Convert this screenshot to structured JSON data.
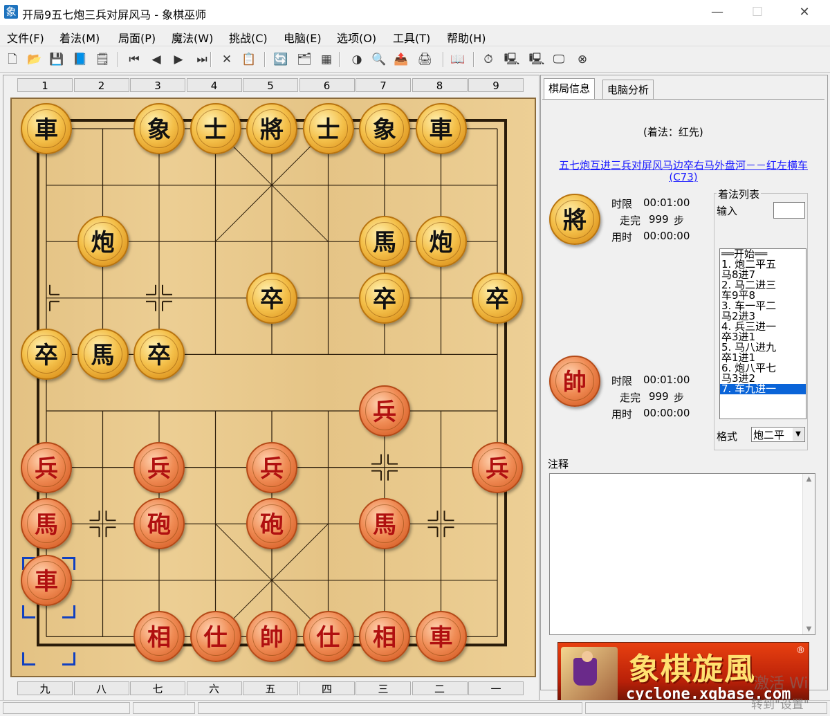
{
  "window": {
    "title": "开局9五七炮三兵对屏风马 - 象棋巫师",
    "app_icon": "象",
    "minimize": "—",
    "maximize": "☐",
    "close": "✕"
  },
  "menu": [
    "文件(F)",
    "着法(M)",
    "局面(P)",
    "魔法(W)",
    "挑战(C)",
    "电脑(E)",
    "选项(O)",
    "工具(T)",
    "帮助(H)"
  ],
  "toolbar_icons": [
    "new-file-icon",
    "open-folder-icon",
    "save-icon",
    "book-icon",
    "properties-icon",
    "first-move-icon",
    "prev-move-icon",
    "next-move-icon",
    "last-move-icon",
    "delete-icon",
    "paste-icon",
    "flip-board-icon",
    "move-tree-icon",
    "board-grid-icon",
    "color-wheel-icon",
    "search-icon",
    "export-icon",
    "print-icon",
    "manual-icon",
    "timer-icon",
    "engine-1-icon",
    "engine-2-icon",
    "monitor-icon",
    "stop-icon"
  ],
  "toolbar_glyphs": [
    "🗋",
    "📂",
    "💾",
    "📘",
    "🗒",
    "⏮",
    "◀",
    "▶",
    "⏭",
    "✕",
    "📋",
    "🔄",
    "🗂",
    "▦",
    "◑",
    "🔍",
    "📤",
    "🖨",
    "📖",
    "⏱",
    "🖳",
    "🖳",
    "🖵",
    "⊗"
  ],
  "board": {
    "top_numbers": [
      "1",
      "2",
      "3",
      "4",
      "5",
      "6",
      "7",
      "8",
      "9"
    ],
    "bottom_numbers": [
      "九",
      "八",
      "七",
      "六",
      "五",
      "四",
      "三",
      "二",
      "一"
    ],
    "pieces": [
      {
        "name": "black-chariot",
        "ch": "車",
        "side": "black"
      },
      {
        "name": "black-elephant",
        "ch": "象",
        "side": "black"
      },
      {
        "name": "black-advisor",
        "ch": "士",
        "side": "black"
      },
      {
        "name": "black-general",
        "ch": "將",
        "side": "black"
      },
      {
        "name": "black-advisor",
        "ch": "士",
        "side": "black"
      },
      {
        "name": "black-elephant",
        "ch": "象",
        "side": "black"
      },
      {
        "name": "black-chariot",
        "ch": "車",
        "side": "black"
      },
      {
        "name": "black-cannon",
        "ch": "炮",
        "side": "black"
      },
      {
        "name": "black-horse",
        "ch": "馬",
        "side": "black"
      },
      {
        "name": "black-cannon",
        "ch": "炮",
        "side": "black"
      },
      {
        "name": "black-soldier",
        "ch": "卒",
        "side": "black"
      },
      {
        "name": "black-soldier",
        "ch": "卒",
        "side": "black"
      },
      {
        "name": "black-soldier",
        "ch": "卒",
        "side": "black"
      },
      {
        "name": "black-soldier",
        "ch": "卒",
        "side": "black"
      },
      {
        "name": "black-horse",
        "ch": "馬",
        "side": "black"
      },
      {
        "name": "black-soldier",
        "ch": "卒",
        "side": "black"
      },
      {
        "name": "red-soldier",
        "ch": "兵",
        "side": "red"
      },
      {
        "name": "red-soldier",
        "ch": "兵",
        "side": "red"
      },
      {
        "name": "red-soldier",
        "ch": "兵",
        "side": "red"
      },
      {
        "name": "red-soldier",
        "ch": "兵",
        "side": "red"
      },
      {
        "name": "red-soldier",
        "ch": "兵",
        "side": "red"
      },
      {
        "name": "red-horse",
        "ch": "馬",
        "side": "red"
      },
      {
        "name": "red-cannon",
        "ch": "砲",
        "side": "red"
      },
      {
        "name": "red-cannon",
        "ch": "砲",
        "side": "red"
      },
      {
        "name": "red-horse",
        "ch": "馬",
        "side": "red"
      },
      {
        "name": "red-chariot",
        "ch": "車",
        "side": "red"
      },
      {
        "name": "red-elephant",
        "ch": "相",
        "side": "red"
      },
      {
        "name": "red-advisor",
        "ch": "仕",
        "side": "red"
      },
      {
        "name": "red-general",
        "ch": "帥",
        "side": "red"
      },
      {
        "name": "red-advisor",
        "ch": "仕",
        "side": "red"
      },
      {
        "name": "red-elephant",
        "ch": "相",
        "side": "red"
      },
      {
        "name": "red-chariot",
        "ch": "車",
        "side": "red"
      }
    ]
  },
  "panel": {
    "tabs": [
      "棋局信息",
      "电脑分析"
    ],
    "move_side": "(着法：红先)",
    "opening_link": "五七炮互进三兵对屏风马边卒右马外盘河－－红左横车(C73)",
    "black_player": {
      "piece": "將",
      "time_limit_label": "时限",
      "time_limit": "00:01:00",
      "moves_label": "走完",
      "moves": "999",
      "moves_unit": "步",
      "used_label": "用时",
      "used": "00:00:00"
    },
    "red_player": {
      "piece": "帥",
      "time_limit_label": "时限",
      "time_limit": "00:01:00",
      "moves_label": "走完",
      "moves": "999",
      "moves_unit": "步",
      "used_label": "用时",
      "used": "00:00:00"
    },
    "move_list_title": "着法列表",
    "input_label": "输入",
    "moves": [
      "══开始══",
      "1. 炮二平五",
      "   马8进7",
      "2. 马二进三",
      "   车9平8",
      "3. 车一平二",
      "   马2进3",
      "4. 兵三进一",
      "   卒3进1",
      "5. 马八进九",
      "   卒1进1",
      "6. 炮八平七",
      "   马3进2",
      "7. 车九进一"
    ],
    "format_label": "格式",
    "format_value": "炮二平",
    "notes_label": "注释",
    "banner_title": "象棋旋風",
    "banner_url": "cyclone.xqbase.com",
    "banner_reg": "®"
  },
  "watermark": {
    "line1": "激活 Wi",
    "line2": "转到\"设置\""
  }
}
